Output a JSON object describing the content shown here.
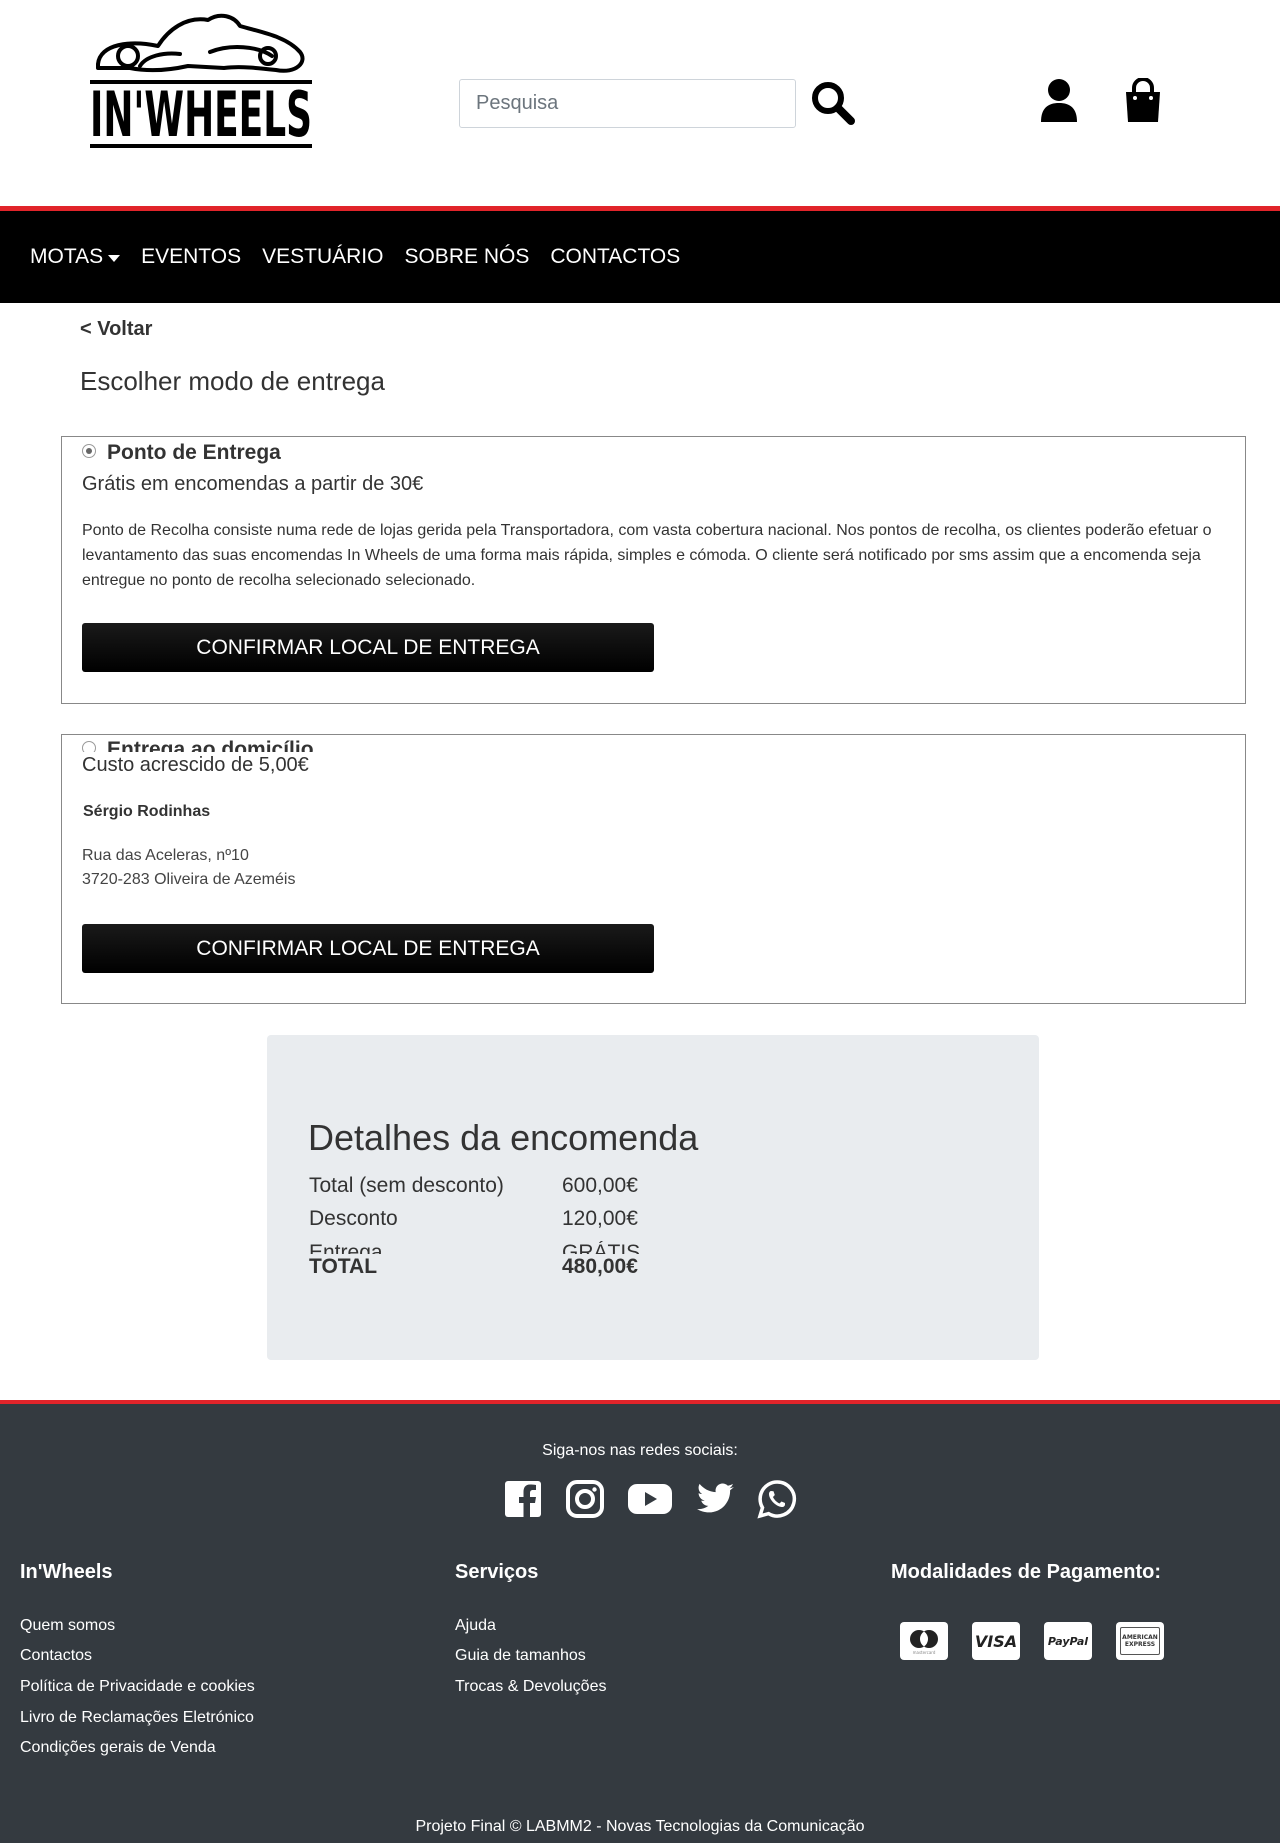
{
  "header": {
    "logo_text": "IN'WHEELS",
    "search_placeholder": "Pesquisa"
  },
  "nav": {
    "items": [
      {
        "label": "MOTAS",
        "dropdown": true
      },
      {
        "label": "EVENTOS"
      },
      {
        "label": "VESTUÁRIO"
      },
      {
        "label": "SOBRE NÓS"
      },
      {
        "label": "CONTACTOS"
      }
    ]
  },
  "main": {
    "back_label": "< Voltar",
    "title": "Escolher modo de entrega",
    "options": [
      {
        "label": "Ponto de Entrega",
        "selected": true,
        "price": "Grátis em encomendas a partir de 30€",
        "description": "Ponto de Recolha consiste numa rede de lojas gerida pela Transportadora, com vasta cobertura nacional. Nos pontos de recolha, os clientes poderão efetuar o levantamento das suas encomendas In Wheels de uma forma mais rápida, simples e cómoda. O cliente será notificado por sms assim que a encomenda seja entregue no ponto de recolha selecionado selecionado.",
        "button": "CONFIRMAR LOCAL DE ENTREGA"
      },
      {
        "label": "Entrega ao domicílio",
        "selected": false,
        "price": "Custo acrescido de 5,00€",
        "recipient": "Sérgio Rodinhas",
        "address_line1": "Rua das Aceleras, nº10",
        "address_line2": "3720-283 Oliveira de Azeméis",
        "button": "CONFIRMAR LOCAL DE ENTREGA"
      }
    ]
  },
  "order": {
    "title": "Detalhes da encomenda",
    "rows": [
      {
        "label": "Total (sem desconto)",
        "value": "600,00€"
      },
      {
        "label": "Desconto",
        "value": "120,00€"
      },
      {
        "label": "Entrega",
        "value": "GRÁTIS"
      }
    ],
    "total_label": "TOTAL",
    "total_value": "480,00€"
  },
  "footer": {
    "social_title": "Siga-nos nas redes sociais:",
    "social_icons": [
      "facebook-icon",
      "instagram-icon",
      "youtube-icon",
      "twitter-icon",
      "whatsapp-icon"
    ],
    "col1": {
      "title": "In'Wheels",
      "links": [
        "Quem somos",
        "Contactos",
        "Política de Privacidade e cookies",
        "Livro de Reclamações Eletrónico",
        "Condições gerais de Venda"
      ]
    },
    "col2": {
      "title": "Serviços",
      "links": [
        "Ajuda",
        "Guia de tamanhos",
        "Trocas & Devoluções"
      ]
    },
    "col3": {
      "title": "Modalidades de Pagamento:",
      "cards": [
        "mastercard",
        "VISA",
        "PayPal",
        "AMERICAN EXPRESS"
      ]
    },
    "copyright": "Projeto Final © LABMM2 - Novas Tecnologias da Comunicação"
  },
  "colors": {
    "accent_red": "#e1242a",
    "navbar": "#000000",
    "footer": "#343a40",
    "order_box": "#e9ecef"
  }
}
